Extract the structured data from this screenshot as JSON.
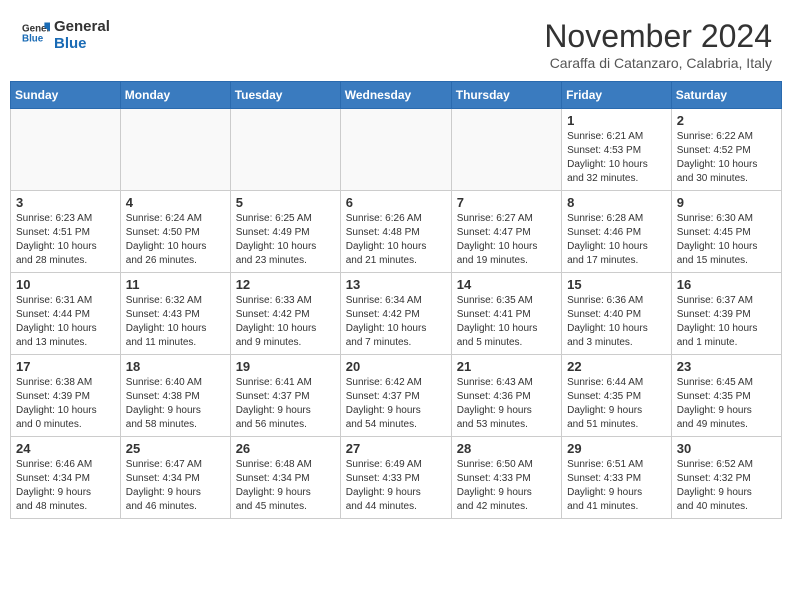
{
  "header": {
    "logo_line1": "General",
    "logo_line2": "Blue",
    "month_title": "November 2024",
    "subtitle": "Caraffa di Catanzaro, Calabria, Italy"
  },
  "calendar": {
    "days_of_week": [
      "Sunday",
      "Monday",
      "Tuesday",
      "Wednesday",
      "Thursday",
      "Friday",
      "Saturday"
    ],
    "weeks": [
      [
        {
          "day": "",
          "info": ""
        },
        {
          "day": "",
          "info": ""
        },
        {
          "day": "",
          "info": ""
        },
        {
          "day": "",
          "info": ""
        },
        {
          "day": "",
          "info": ""
        },
        {
          "day": "1",
          "info": "Sunrise: 6:21 AM\nSunset: 4:53 PM\nDaylight: 10 hours\nand 32 minutes."
        },
        {
          "day": "2",
          "info": "Sunrise: 6:22 AM\nSunset: 4:52 PM\nDaylight: 10 hours\nand 30 minutes."
        }
      ],
      [
        {
          "day": "3",
          "info": "Sunrise: 6:23 AM\nSunset: 4:51 PM\nDaylight: 10 hours\nand 28 minutes."
        },
        {
          "day": "4",
          "info": "Sunrise: 6:24 AM\nSunset: 4:50 PM\nDaylight: 10 hours\nand 26 minutes."
        },
        {
          "day": "5",
          "info": "Sunrise: 6:25 AM\nSunset: 4:49 PM\nDaylight: 10 hours\nand 23 minutes."
        },
        {
          "day": "6",
          "info": "Sunrise: 6:26 AM\nSunset: 4:48 PM\nDaylight: 10 hours\nand 21 minutes."
        },
        {
          "day": "7",
          "info": "Sunrise: 6:27 AM\nSunset: 4:47 PM\nDaylight: 10 hours\nand 19 minutes."
        },
        {
          "day": "8",
          "info": "Sunrise: 6:28 AM\nSunset: 4:46 PM\nDaylight: 10 hours\nand 17 minutes."
        },
        {
          "day": "9",
          "info": "Sunrise: 6:30 AM\nSunset: 4:45 PM\nDaylight: 10 hours\nand 15 minutes."
        }
      ],
      [
        {
          "day": "10",
          "info": "Sunrise: 6:31 AM\nSunset: 4:44 PM\nDaylight: 10 hours\nand 13 minutes."
        },
        {
          "day": "11",
          "info": "Sunrise: 6:32 AM\nSunset: 4:43 PM\nDaylight: 10 hours\nand 11 minutes."
        },
        {
          "day": "12",
          "info": "Sunrise: 6:33 AM\nSunset: 4:42 PM\nDaylight: 10 hours\nand 9 minutes."
        },
        {
          "day": "13",
          "info": "Sunrise: 6:34 AM\nSunset: 4:42 PM\nDaylight: 10 hours\nand 7 minutes."
        },
        {
          "day": "14",
          "info": "Sunrise: 6:35 AM\nSunset: 4:41 PM\nDaylight: 10 hours\nand 5 minutes."
        },
        {
          "day": "15",
          "info": "Sunrise: 6:36 AM\nSunset: 4:40 PM\nDaylight: 10 hours\nand 3 minutes."
        },
        {
          "day": "16",
          "info": "Sunrise: 6:37 AM\nSunset: 4:39 PM\nDaylight: 10 hours\nand 1 minute."
        }
      ],
      [
        {
          "day": "17",
          "info": "Sunrise: 6:38 AM\nSunset: 4:39 PM\nDaylight: 10 hours\nand 0 minutes."
        },
        {
          "day": "18",
          "info": "Sunrise: 6:40 AM\nSunset: 4:38 PM\nDaylight: 9 hours\nand 58 minutes."
        },
        {
          "day": "19",
          "info": "Sunrise: 6:41 AM\nSunset: 4:37 PM\nDaylight: 9 hours\nand 56 minutes."
        },
        {
          "day": "20",
          "info": "Sunrise: 6:42 AM\nSunset: 4:37 PM\nDaylight: 9 hours\nand 54 minutes."
        },
        {
          "day": "21",
          "info": "Sunrise: 6:43 AM\nSunset: 4:36 PM\nDaylight: 9 hours\nand 53 minutes."
        },
        {
          "day": "22",
          "info": "Sunrise: 6:44 AM\nSunset: 4:35 PM\nDaylight: 9 hours\nand 51 minutes."
        },
        {
          "day": "23",
          "info": "Sunrise: 6:45 AM\nSunset: 4:35 PM\nDaylight: 9 hours\nand 49 minutes."
        }
      ],
      [
        {
          "day": "24",
          "info": "Sunrise: 6:46 AM\nSunset: 4:34 PM\nDaylight: 9 hours\nand 48 minutes."
        },
        {
          "day": "25",
          "info": "Sunrise: 6:47 AM\nSunset: 4:34 PM\nDaylight: 9 hours\nand 46 minutes."
        },
        {
          "day": "26",
          "info": "Sunrise: 6:48 AM\nSunset: 4:34 PM\nDaylight: 9 hours\nand 45 minutes."
        },
        {
          "day": "27",
          "info": "Sunrise: 6:49 AM\nSunset: 4:33 PM\nDaylight: 9 hours\nand 44 minutes."
        },
        {
          "day": "28",
          "info": "Sunrise: 6:50 AM\nSunset: 4:33 PM\nDaylight: 9 hours\nand 42 minutes."
        },
        {
          "day": "29",
          "info": "Sunrise: 6:51 AM\nSunset: 4:33 PM\nDaylight: 9 hours\nand 41 minutes."
        },
        {
          "day": "30",
          "info": "Sunrise: 6:52 AM\nSunset: 4:32 PM\nDaylight: 9 hours\nand 40 minutes."
        }
      ]
    ]
  }
}
